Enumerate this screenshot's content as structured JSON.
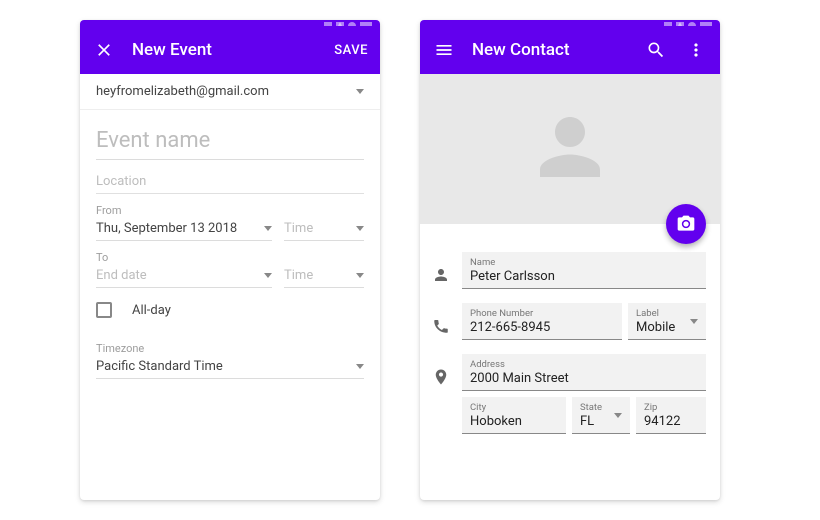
{
  "colors": {
    "primary": "#6200ee"
  },
  "event": {
    "appbar": {
      "title": "New Event",
      "save": "SAVE"
    },
    "account": "heyfromelizabeth@gmail.com",
    "eventNamePlaceholder": "Event name",
    "locationPlaceholder": "Location",
    "fromLabel": "From",
    "fromDate": "Thu, September 13 2018",
    "fromTimePlaceholder": "Time",
    "toLabel": "To",
    "toDatePlaceholder": "End date",
    "toTimePlaceholder": "Time",
    "allDayLabel": "All-day",
    "timezoneLabel": "Timezone",
    "timezoneValue": "Pacific Standard Time"
  },
  "contact": {
    "appbar": {
      "title": "New Contact"
    },
    "name": {
      "label": "Name",
      "value": "Peter Carlsson"
    },
    "phone": {
      "label": "Phone Number",
      "value": "212-665-8945"
    },
    "phoneLabel": {
      "label": "Label",
      "value": "Mobile"
    },
    "address": {
      "label": "Address",
      "value": "2000 Main Street"
    },
    "city": {
      "label": "City",
      "value": "Hoboken"
    },
    "state": {
      "label": "State",
      "value": "FL"
    },
    "zip": {
      "label": "Zip",
      "value": "94122"
    }
  }
}
